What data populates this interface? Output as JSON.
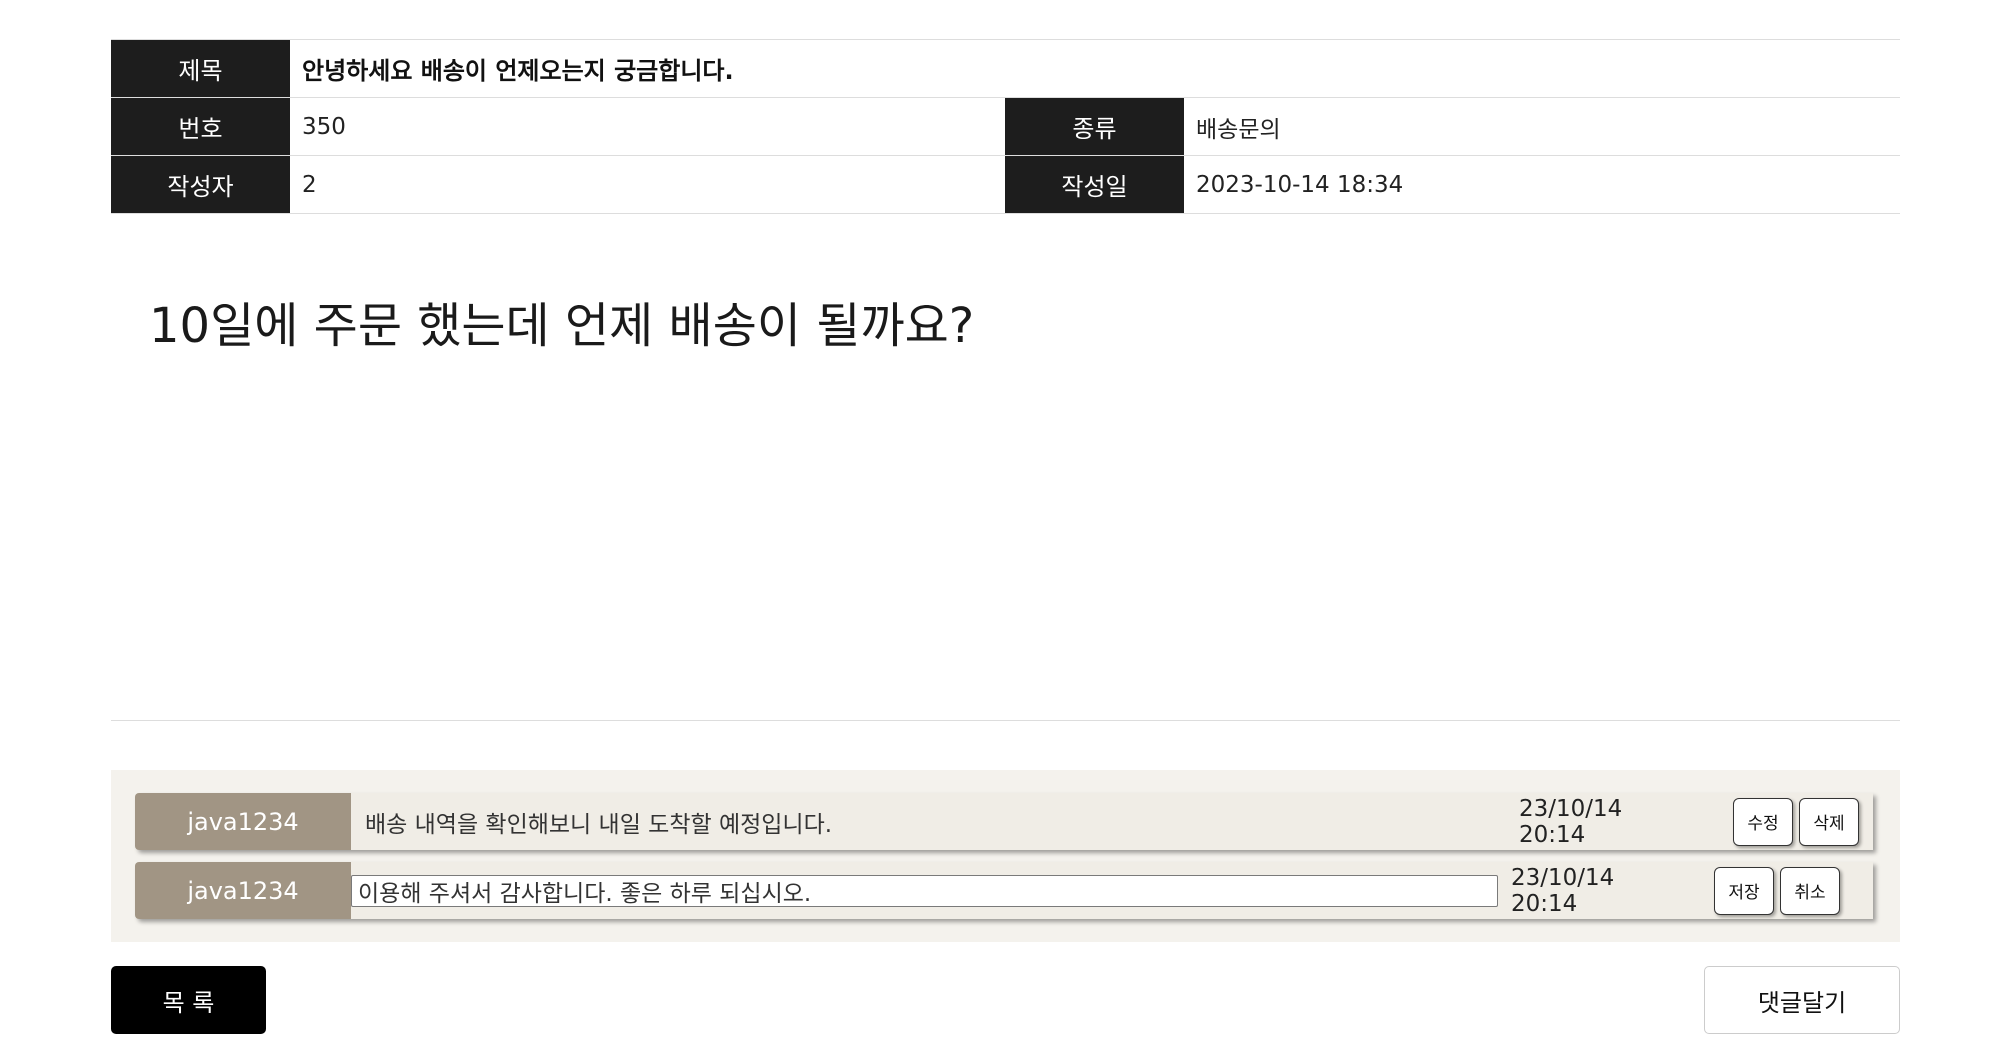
{
  "post": {
    "title_label": "제목",
    "title": "안녕하세요 배송이 언제오는지 궁금합니다.",
    "number_label": "번호",
    "number": "350",
    "category_label": "종류",
    "category": "배송문의",
    "author_label": "작성자",
    "author": "2",
    "date_label": "작성일",
    "date": "2023-10-14 18:34",
    "content": "10일에 주문 했는데 언제 배송이 될까요?"
  },
  "comments": [
    {
      "author": "java1234",
      "text": "배송 내역을 확인해보니 내일 도착할 예정입니다.",
      "date": "23/10/14 20:14",
      "edit_label": "수정",
      "delete_label": "삭제"
    },
    {
      "author": "java1234",
      "text": "이용해 주셔서 감사합니다. 좋은 하루 되십시오.",
      "date": "23/10/14 20:14",
      "save_label": "저장",
      "cancel_label": "취소"
    }
  ],
  "actions": {
    "list_label": "목 록",
    "reply_label": "댓글달기"
  },
  "colors": {
    "label_bg": "#1d1d1d",
    "author_bg": "#a19584",
    "comment_area_bg": "#f4f2ed"
  }
}
